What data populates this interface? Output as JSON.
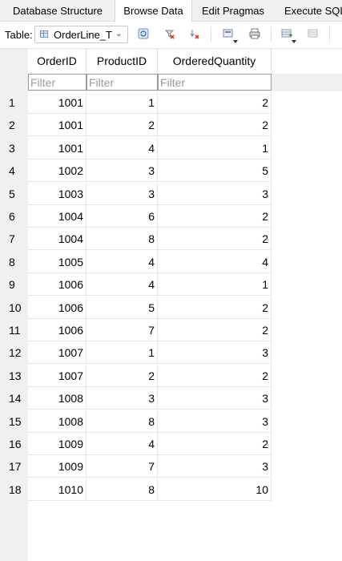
{
  "tabs": [
    "Database Structure",
    "Browse Data",
    "Edit Pragmas",
    "Execute SQL"
  ],
  "toolbar": {
    "table_label": "Table:",
    "table_value": "OrderLine_T",
    "icons": [
      "refresh-icon",
      "clear-filters-icon",
      "clear-sort-icon",
      "save-results-icon",
      "print-icon",
      "insert-record-icon",
      "delete-record-icon"
    ]
  },
  "columns": [
    "OrderID",
    "ProductID",
    "OrderedQuantity"
  ],
  "filter_placeholder": "Filter",
  "rows": [
    [
      "1",
      "1001",
      "1",
      "2"
    ],
    [
      "2",
      "1001",
      "2",
      "2"
    ],
    [
      "3",
      "1001",
      "4",
      "1"
    ],
    [
      "4",
      "1002",
      "3",
      "5"
    ],
    [
      "5",
      "1003",
      "3",
      "3"
    ],
    [
      "6",
      "1004",
      "6",
      "2"
    ],
    [
      "7",
      "1004",
      "8",
      "2"
    ],
    [
      "8",
      "1005",
      "4",
      "4"
    ],
    [
      "9",
      "1006",
      "4",
      "1"
    ],
    [
      "10",
      "1006",
      "5",
      "2"
    ],
    [
      "11",
      "1006",
      "7",
      "2"
    ],
    [
      "12",
      "1007",
      "1",
      "3"
    ],
    [
      "13",
      "1007",
      "2",
      "2"
    ],
    [
      "14",
      "1008",
      "3",
      "3"
    ],
    [
      "15",
      "1008",
      "8",
      "3"
    ],
    [
      "16",
      "1009",
      "4",
      "2"
    ],
    [
      "17",
      "1009",
      "7",
      "3"
    ],
    [
      "18",
      "1010",
      "8",
      "10"
    ]
  ]
}
